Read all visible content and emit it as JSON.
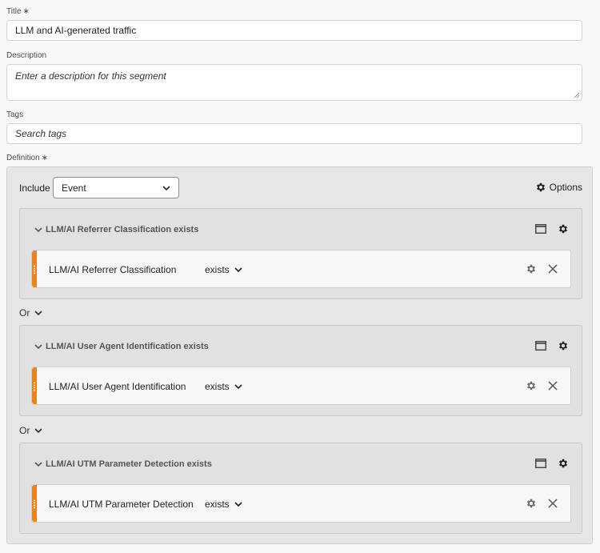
{
  "form": {
    "title_label": "Title",
    "required_mark": "∗",
    "title_value": "LLM and AI-generated traffic",
    "description_label": "Description",
    "description_placeholder": "Enter a description for this segment",
    "tags_label": "Tags",
    "tags_placeholder": "Search tags",
    "definition_label": "Definition"
  },
  "definition": {
    "include_label": "Include",
    "scope_value": "Event",
    "options_label": "Options",
    "or_label": "Or",
    "containers": [
      {
        "header": "LLM/AI Referrer Classification exists",
        "rule": {
          "dimension": "LLM/AI Referrer Classification",
          "operator": "exists"
        }
      },
      {
        "header": "LLM/AI User Agent Identification exists",
        "rule": {
          "dimension": "LLM/AI User Agent Identification",
          "operator": "exists"
        }
      },
      {
        "header": "LLM/AI UTM Parameter Detection exists",
        "rule": {
          "dimension": "LLM/AI UTM Parameter Detection",
          "operator": "exists"
        }
      }
    ]
  },
  "colors": {
    "accent": "#e68619",
    "page_bg": "#f8f8f8",
    "definition_bg": "#e6e6e6"
  },
  "icons": [
    "chevron-down-icon",
    "gear-icon",
    "window-icon",
    "close-icon",
    "drag-handle-icon"
  ]
}
